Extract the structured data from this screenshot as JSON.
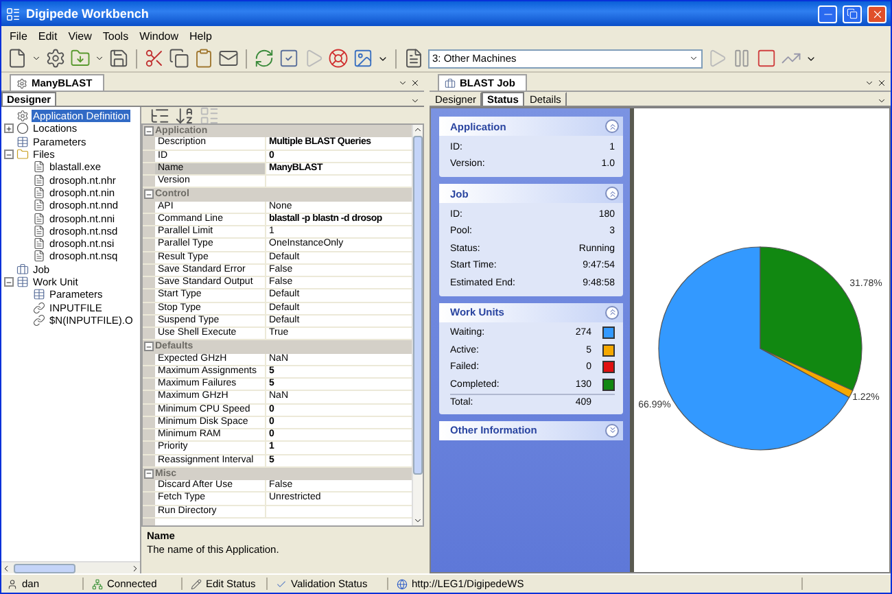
{
  "window": {
    "title": "Digipede Workbench"
  },
  "menu": [
    "File",
    "Edit",
    "View",
    "Tools",
    "Window",
    "Help"
  ],
  "toolbar": {
    "machine_select": {
      "value": "3: Other Machines"
    }
  },
  "left_pane": {
    "tab": "ManyBLAST",
    "subtab": "Designer",
    "tree": [
      {
        "label": "Application Definition",
        "kind": "gear",
        "selected": true
      },
      {
        "label": "Locations",
        "kind": "location",
        "selected": false,
        "expanded": false
      },
      {
        "label": "Parameters",
        "kind": "params",
        "selected": false
      },
      {
        "label": "Files",
        "kind": "folder",
        "selected": false,
        "expanded": true,
        "children": [
          {
            "label": "blastall.exe",
            "kind": "file",
            "selected": false
          },
          {
            "label": "drosoph.nt.nhr",
            "kind": "file",
            "selected": false
          },
          {
            "label": "drosoph.nt.nin",
            "kind": "file",
            "selected": false
          },
          {
            "label": "drosoph.nt.nnd",
            "kind": "file",
            "selected": false
          },
          {
            "label": "drosoph.nt.nni",
            "kind": "file",
            "selected": false
          },
          {
            "label": "drosoph.nt.nsd",
            "kind": "file",
            "selected": false
          },
          {
            "label": "drosoph.nt.nsi",
            "kind": "file",
            "selected": false
          },
          {
            "label": "drosoph.nt.nsq",
            "kind": "file",
            "selected": false
          }
        ]
      },
      {
        "label": "Job",
        "kind": "job",
        "selected": false
      },
      {
        "label": "Work Unit",
        "kind": "unit",
        "selected": false,
        "expanded": true,
        "children": [
          {
            "label": "Parameters",
            "kind": "params",
            "selected": false
          },
          {
            "label": "INPUTFILE",
            "kind": "link",
            "selected": false
          },
          {
            "label": "$N(INPUTFILE).O",
            "kind": "link",
            "selected": false
          }
        ]
      }
    ],
    "properties": [
      {
        "name": "Application",
        "expanded": true,
        "rows": [
          {
            "name": "Description",
            "value": "Multiple BLAST Queries",
            "modified": true,
            "selected": false
          },
          {
            "name": "ID",
            "value": "0",
            "modified": true,
            "selected": false
          },
          {
            "name": "Name",
            "value": "ManyBLAST",
            "modified": true,
            "selected": true
          },
          {
            "name": "Version",
            "value": "",
            "selected": false
          }
        ]
      },
      {
        "name": "Control",
        "expanded": true,
        "rows": [
          {
            "name": "API",
            "value": "None",
            "modified": false,
            "selected": false
          },
          {
            "name": "Command Line",
            "value": "blastall -p blastn -d drosop",
            "modified": true,
            "selected": false
          },
          {
            "name": "Parallel Limit",
            "value": "1",
            "modified": false,
            "selected": false
          },
          {
            "name": "Parallel Type",
            "value": "OneInstanceOnly",
            "modified": false,
            "selected": false
          },
          {
            "name": "Result Type",
            "value": "Default",
            "modified": false,
            "selected": false
          },
          {
            "name": "Save Standard Error",
            "value": "False",
            "modified": false,
            "selected": false
          },
          {
            "name": "Save Standard Output",
            "value": "False",
            "modified": false,
            "selected": false
          },
          {
            "name": "Start Type",
            "value": "Default",
            "modified": false,
            "selected": false
          },
          {
            "name": "Stop Type",
            "value": "Default",
            "modified": false,
            "selected": false
          },
          {
            "name": "Suspend Type",
            "value": "Default",
            "modified": false,
            "selected": false
          },
          {
            "name": "Use Shell Execute",
            "value": "True",
            "modified": false,
            "selected": false
          }
        ]
      },
      {
        "name": "Defaults",
        "expanded": true,
        "rows": [
          {
            "name": "Expected GHzH",
            "value": "NaN",
            "modified": false,
            "selected": false
          },
          {
            "name": "Maximum Assignments",
            "value": "5",
            "modified": true,
            "selected": false
          },
          {
            "name": "Maximum Failures",
            "value": "5",
            "modified": true,
            "selected": false
          },
          {
            "name": "Maximum GHzH",
            "value": "NaN",
            "modified": false,
            "selected": false
          },
          {
            "name": "Minimum CPU Speed",
            "value": "0",
            "modified": true,
            "selected": false
          },
          {
            "name": "Minimum Disk Space",
            "value": "0",
            "modified": true,
            "selected": false
          },
          {
            "name": "Minimum RAM",
            "value": "0",
            "modified": true,
            "selected": false
          },
          {
            "name": "Priority",
            "value": "1",
            "modified": true,
            "selected": false
          },
          {
            "name": "Reassignment Interval",
            "value": "5",
            "modified": true,
            "selected": false
          }
        ]
      },
      {
        "name": "Misc",
        "expanded": true,
        "rows": [
          {
            "name": "Discard After Use",
            "value": "False",
            "modified": false,
            "selected": false
          },
          {
            "name": "Fetch Type",
            "value": "Unrestricted",
            "modified": false,
            "selected": false
          },
          {
            "name": "Run Directory",
            "value": "",
            "selected": false
          }
        ]
      }
    ],
    "description": {
      "title": "Name",
      "text": "The name of this Application."
    }
  },
  "right_pane": {
    "tab": "BLAST Job",
    "tabs": [
      {
        "label": "Designer",
        "selected": false
      },
      {
        "label": "Status",
        "selected": true
      },
      {
        "label": "Details",
        "selected": false
      }
    ],
    "sections": [
      {
        "title": "Application",
        "kind": "fields",
        "expanded": true,
        "fields": [
          {
            "label": "ID:",
            "value": "1"
          },
          {
            "label": "Version:",
            "value": "1.0"
          }
        ]
      },
      {
        "title": "Job",
        "kind": "fields",
        "expanded": true,
        "fields": [
          {
            "label": "ID:",
            "value": "180"
          },
          {
            "label": "Pool:",
            "value": "3"
          },
          {
            "label": "Status:",
            "value": "Running"
          },
          {
            "label": "Start Time:",
            "value": "9:47:54"
          },
          {
            "label": "Estimated End:",
            "value": "9:48:58"
          }
        ]
      },
      {
        "title": "Work Units",
        "kind": "units",
        "expanded": true,
        "fields": [
          {
            "label": "Waiting:",
            "value": "274",
            "color": "#3399ff"
          },
          {
            "label": "Active:",
            "value": "5",
            "color": "#f5a800"
          },
          {
            "label": "Failed:",
            "value": "0",
            "color": "#e01010"
          },
          {
            "label": "Completed:",
            "value": "130",
            "color": "#118811"
          }
        ],
        "total": {
          "label": "Total:",
          "value": "409"
        }
      },
      {
        "title": "Other Information",
        "expanded": false
      }
    ],
    "chart_data": {
      "type": "pie",
      "values": [
        66.99,
        1.22,
        0,
        31.78
      ],
      "value_labels": [
        "66.99%",
        "1.22%",
        null,
        "31.78%"
      ]
    }
  },
  "status_bar": [
    {
      "kind": "user",
      "text": "dan"
    },
    {
      "kind": "connection",
      "text": "Connected"
    },
    {
      "kind": "edit",
      "text": "Edit Status"
    },
    {
      "kind": "validation",
      "text": "Validation Status"
    },
    {
      "kind": "server",
      "text": "http://LEG1/DigipedeWS"
    }
  ]
}
